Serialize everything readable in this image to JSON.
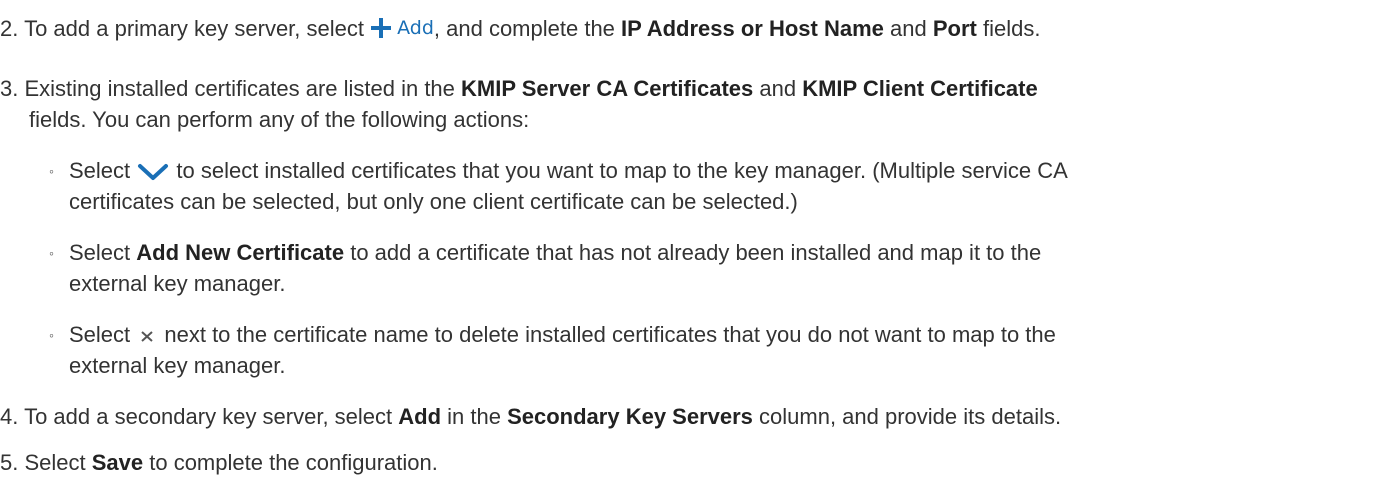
{
  "steps": {
    "step2": {
      "number": "2.",
      "t1": " To add a primary key server, select ",
      "add_label": "Add",
      "t2": ", and complete the ",
      "b1": "IP Address or Host Name",
      "t3": " and ",
      "b2": "Port",
      "t4": " fields."
    },
    "step3": {
      "number": "3.",
      "t1": " Existing installed certificates are listed in the ",
      "b1": "KMIP Server CA Certificates",
      "t2": " and ",
      "b2": "KMIP Client Certificate",
      "line2": "fields. You can perform any of the following actions:",
      "bullets": {
        "a": {
          "t1": "Select ",
          "t2": " to select installed certificates that you want to map to the key manager. (Multiple service CA",
          "line2": "certificates can be selected, but only one client certificate can be selected.)"
        },
        "b": {
          "t1": "Select ",
          "b1": "Add New Certificate",
          "t2": " to add a certificate that has not already been installed and map it to the",
          "line2": "external key manager."
        },
        "c": {
          "t1": "Select ",
          "t2": " next to the certificate name to delete installed certificates that you do not want to map to the",
          "line2": "external key manager."
        }
      }
    },
    "step4": {
      "number": "4.",
      "t1": " To add a secondary key server, select ",
      "b1": "Add",
      "t2": " in the ",
      "b2": "Secondary Key Servers",
      "t3": " column, and provide its details."
    },
    "step5": {
      "number": "5.",
      "t1": " Select ",
      "b1": "Save",
      "t2": " to complete the configuration."
    }
  },
  "bullet_glyph": "◦",
  "icons": {
    "add": "plus-icon",
    "chevron": "chevron-down-icon",
    "close": "close-icon"
  },
  "colors": {
    "text": "#333333",
    "accent": "#1a6fb6"
  }
}
